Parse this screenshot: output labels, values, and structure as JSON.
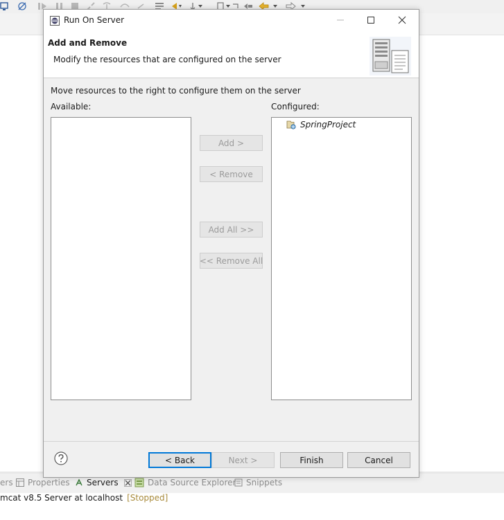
{
  "ide": {
    "bottom_tabs": [
      {
        "label": "ers"
      },
      {
        "label": "Properties"
      },
      {
        "label": "Servers",
        "close_icon": "close-tab-icon"
      },
      {
        "label": "Data Source Explorer"
      },
      {
        "label": "Snippets"
      }
    ],
    "server_entry": {
      "name": "mcat v8.5 Server at localhost",
      "status": "[Stopped]"
    }
  },
  "dialog": {
    "title": "Run On Server",
    "header": {
      "title": "Add and Remove",
      "description": "Modify the resources that are configured on the server"
    },
    "instruction": "Move resources to the right to configure them on the server",
    "available_label": "Available:",
    "configured_label": "Configured:",
    "available_items": [],
    "configured_items": [
      {
        "label": "SpringProject",
        "icon": "web-project-icon"
      }
    ],
    "buttons": {
      "add": "Add >",
      "remove": "< Remove",
      "add_all": "Add All >>",
      "remove_all": "<< Remove All",
      "back": "< Back",
      "next": "Next >",
      "finish": "Finish",
      "cancel": "Cancel"
    }
  },
  "colors": {
    "dialog_bg": "#f0f0f0",
    "default_button_border": "#0078d7",
    "disabled_text": "#9b9b9b",
    "status_stopped": "#a88a3a"
  }
}
